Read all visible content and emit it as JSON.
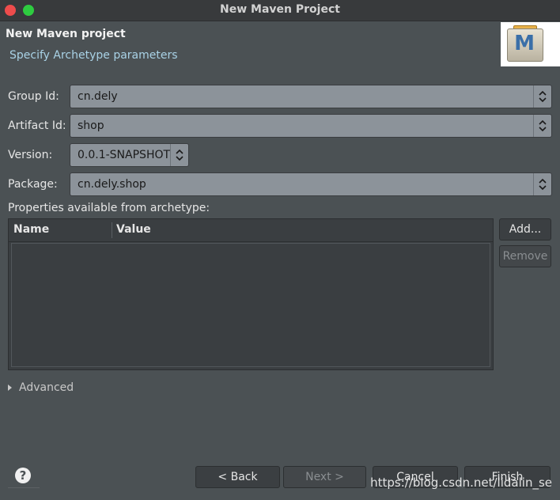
{
  "window": {
    "title": "New Maven Project"
  },
  "header": {
    "title": "New Maven project",
    "description": "Specify Archetype parameters",
    "logo_letter": "M"
  },
  "form": {
    "group_id": {
      "label": "Group Id:",
      "value": "cn.dely"
    },
    "artifact_id": {
      "label": "Artifact Id:",
      "value": "shop"
    },
    "version": {
      "label": "Version:",
      "value": "0.0.1-SNAPSHOT"
    },
    "package": {
      "label": "Package:",
      "value": "cn.dely.shop"
    }
  },
  "properties": {
    "label": "Properties available from archetype:",
    "columns": [
      "Name",
      "Value"
    ],
    "rows": [],
    "add_label": "Add...",
    "remove_label": "Remove"
  },
  "advanced": {
    "label": "Advanced"
  },
  "footer": {
    "back_label": "< Back",
    "next_label": "Next >",
    "cancel_label": "Cancel",
    "finish_label": "Finish",
    "help_icon": "?"
  },
  "watermark": "https://blog.csdn.net/lidalin_se"
}
